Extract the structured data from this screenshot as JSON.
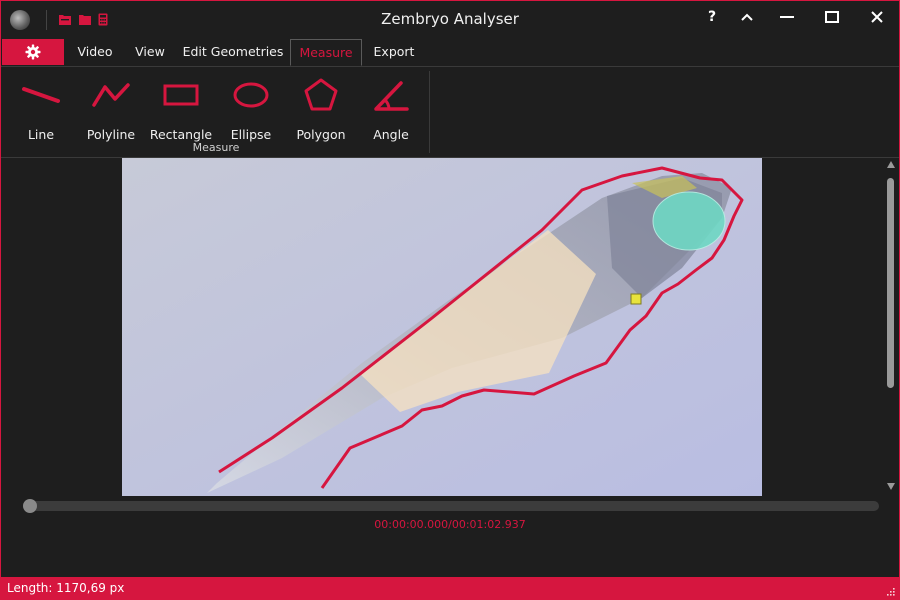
{
  "window": {
    "title": "Zembryo Analyser"
  },
  "titlebar_buttons": {
    "help": "?",
    "minimize": "^",
    "restore": "—",
    "maximize": "□",
    "close": "✕"
  },
  "tabs": [
    {
      "label": "Video"
    },
    {
      "label": "View"
    },
    {
      "label": "Edit Geometries"
    },
    {
      "label": "Measure",
      "active": true
    },
    {
      "label": "Export"
    }
  ],
  "ribbon": {
    "tools": [
      {
        "label": "Line",
        "icon": "line-icon"
      },
      {
        "label": "Polyline",
        "icon": "polyline-icon"
      },
      {
        "label": "Rectangle",
        "icon": "rectangle-icon"
      },
      {
        "label": "Ellipse",
        "icon": "ellipse-icon"
      },
      {
        "label": "Polygon",
        "icon": "polygon-icon"
      },
      {
        "label": "Angle",
        "icon": "angle-icon"
      }
    ],
    "group_label": "Measure"
  },
  "playback": {
    "time": "00:00:00.000/00:01:02.937",
    "position": 0
  },
  "status": {
    "text": "Length: 1170,69 px"
  },
  "colors": {
    "accent": "#d6163f",
    "background": "#1e1e1e",
    "ellipse_fill": "#6fd8c4",
    "polygon_fill": "#f7e2c0"
  }
}
